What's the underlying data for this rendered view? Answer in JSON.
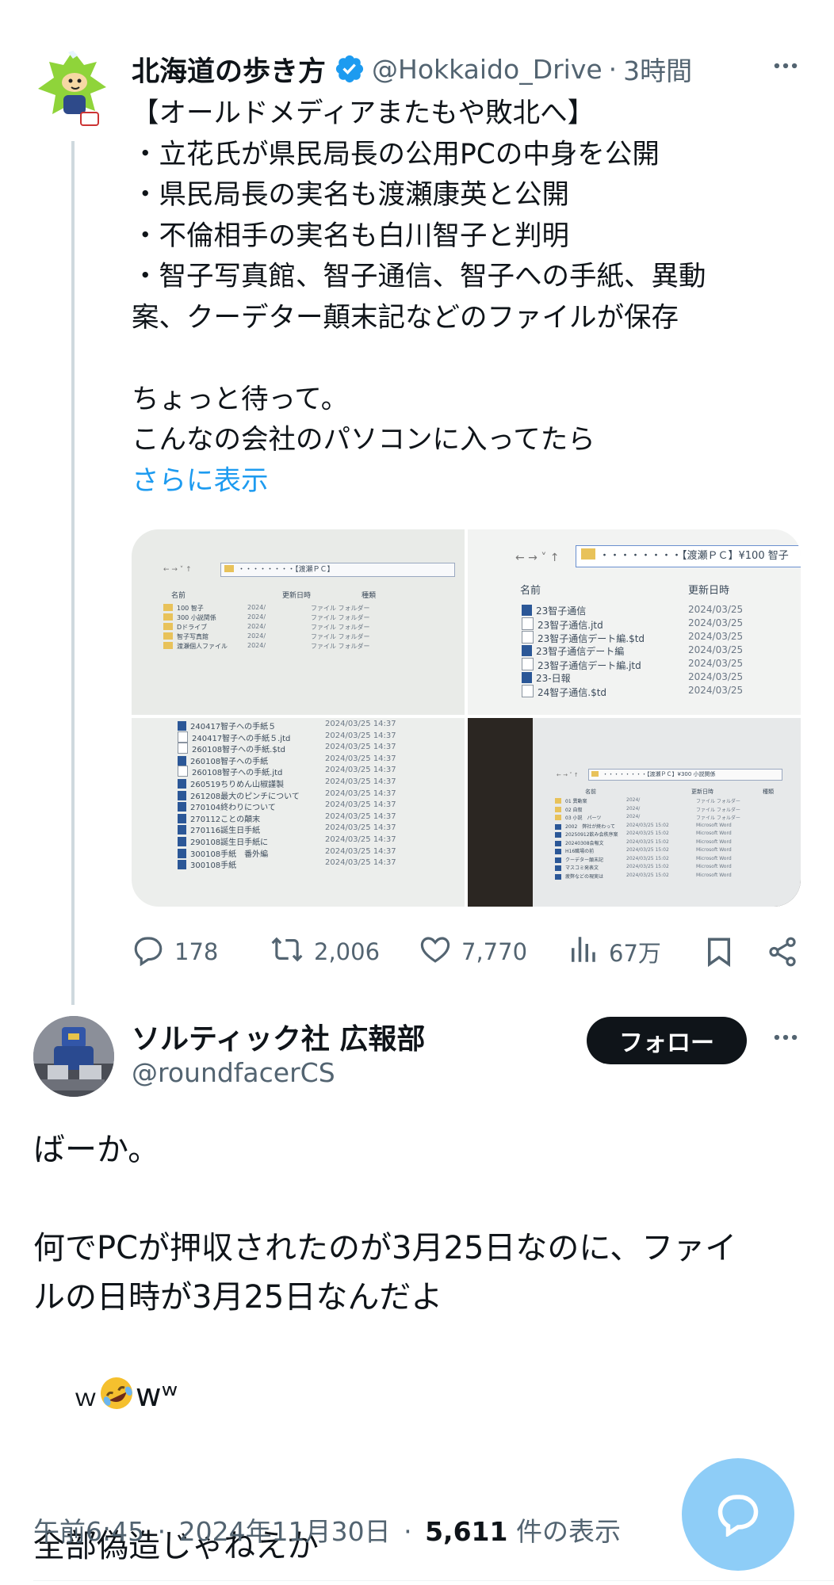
{
  "tweet1": {
    "display_name": "北海道の歩き方",
    "handle": "@Hokkaido_Drive",
    "separator": "·",
    "time": "3時間",
    "body_lines": [
      "【オールドメディアまたもや敗北へ】",
      "・立花氏が県民局長の公用PCの中身を公開",
      "・県民局長の実名も渡瀬康英と公開",
      "・不倫相手の実名も白川智子と判明",
      "・智子写真館、智子通信、智子への手紙、異動",
      "案、クーデター顛末記などのファイルが保存",
      "",
      "ちょっと待って。",
      "こんなの会社のパソコンに入ってたら"
    ],
    "show_more": "さらに表示",
    "actions": {
      "replies": "178",
      "retweets": "2,006",
      "likes": "7,770",
      "views": "67万"
    },
    "photos": {
      "p1": {
        "path": "・・・・・・・・【渡瀬ＰＣ】",
        "headers": [
          "名前",
          "更新日時",
          "種類"
        ],
        "rows": [
          [
            "100 智子",
            "2024/",
            "ファイル フォルダー"
          ],
          [
            "300 小説関係",
            "2024/",
            "ファイル フォルダー"
          ],
          [
            "Dドライブ",
            "2024/",
            "ファイル フォルダー"
          ],
          [
            "智子写真館",
            "2024/",
            "ファイル フォルダー"
          ],
          [
            "渡瀬個人ファイル",
            "2024/",
            "ファイル フォルダー"
          ]
        ]
      },
      "p2": {
        "path": "・・・・・・・・【渡瀬ＰＣ】¥100 智子",
        "headers": [
          "名前",
          "更新日時"
        ],
        "rows": [
          [
            "23智子通信",
            "2024/03/25"
          ],
          [
            "23智子通信.jtd",
            "2024/03/25"
          ],
          [
            "23智子通信デート編.$td",
            "2024/03/25"
          ],
          [
            "23智子通信デート編",
            "2024/03/25"
          ],
          [
            "23智子通信デート編.jtd",
            "2024/03/25"
          ],
          [
            "23-日報",
            "2024/03/25"
          ],
          [
            "24智子通信.$td",
            "2024/03/25"
          ]
        ]
      },
      "p3": {
        "rows": [
          [
            "240417智子への手紙５",
            "2024/03/25 14:37"
          ],
          [
            "240417智子への手紙５.jtd",
            "2024/03/25 14:37"
          ],
          [
            "260108智子への手紙.$td",
            "2024/03/25 14:37"
          ],
          [
            "260108智子への手紙",
            "2024/03/25 14:37"
          ],
          [
            "260108智子への手紙.jtd",
            "2024/03/25 14:37"
          ],
          [
            "260519ちりめん山椒謹製",
            "2024/03/25 14:37"
          ],
          [
            "261208最大のピンチについて",
            "2024/03/25 14:37"
          ],
          [
            "270104終わりについて",
            "2024/03/25 14:37"
          ],
          [
            "270112ことの顛末",
            "2024/03/25 14:37"
          ],
          [
            "270116誕生日手紙",
            "2024/03/25 14:37"
          ],
          [
            "290108誕生日手紙に",
            "2024/03/25 14:37"
          ],
          [
            "300108手紙　番外編",
            "2024/03/25 14:37"
          ],
          [
            "300108手紙",
            "2024/03/25 14:37"
          ]
        ]
      },
      "p4": {
        "path": "・・・・・・・・【渡瀬ＰＣ】¥300 小説関係",
        "headers": [
          "名前",
          "更新日時",
          "種類"
        ],
        "rows": [
          [
            "01 異動案",
            "2024/",
            "ファイル フォルダー"
          ],
          [
            "02 自叙",
            "2024/",
            "ファイル フォルダー"
          ],
          [
            "03 小説　パーツ",
            "2024/",
            "ファイル フォルダー"
          ],
          [
            "2002　弊社が終わって",
            "2024/03/25 15:02",
            "Microsoft Word"
          ],
          [
            "20250912飲み会秩序案",
            "2024/03/25 15:02",
            "Microsoft Word"
          ],
          [
            "20240308会報文",
            "2024/03/25 15:02",
            "Microsoft Word"
          ],
          [
            "H16職場の前",
            "2024/03/25 15:02",
            "Microsoft Word"
          ],
          [
            "クーデター顛末記",
            "2024/03/25 15:02",
            "Microsoft Word"
          ],
          [
            "マスコミ発表文",
            "2024/03/25 15:02",
            "Microsoft Word"
          ],
          [
            "疲弊などの現実は",
            "2024/03/25 15:02",
            "Microsoft Word"
          ]
        ]
      }
    }
  },
  "tweet2": {
    "display_name": "ソルティック社 広報部",
    "handle": "@roundfacerCS",
    "follow_label": "フォロー",
    "body_lines": [
      "ばーか。",
      "",
      "何でPCが押収されたのが3月25日なのに、ファイ",
      "ルの日時が3月25日なんだよ"
    ],
    "laugh_prefix": "ｗ",
    "laugh_suffix": "wʷ",
    "last_line": "全部偽造じゃねえか",
    "meta": {
      "time": "午前6:45",
      "date": "2024年11月30日",
      "views_count": "5,611",
      "views_label": "件の表示",
      "sep": "·"
    }
  },
  "colors": {
    "accent": "#1d9bf0",
    "secondary_text": "#536471",
    "fab": "#8ecdf7"
  },
  "icons": [
    "verified-badge-icon",
    "more-icon",
    "reply-icon",
    "retweet-icon",
    "like-icon",
    "views-icon",
    "bookmark-icon",
    "share-icon",
    "messages-fab-icon"
  ]
}
